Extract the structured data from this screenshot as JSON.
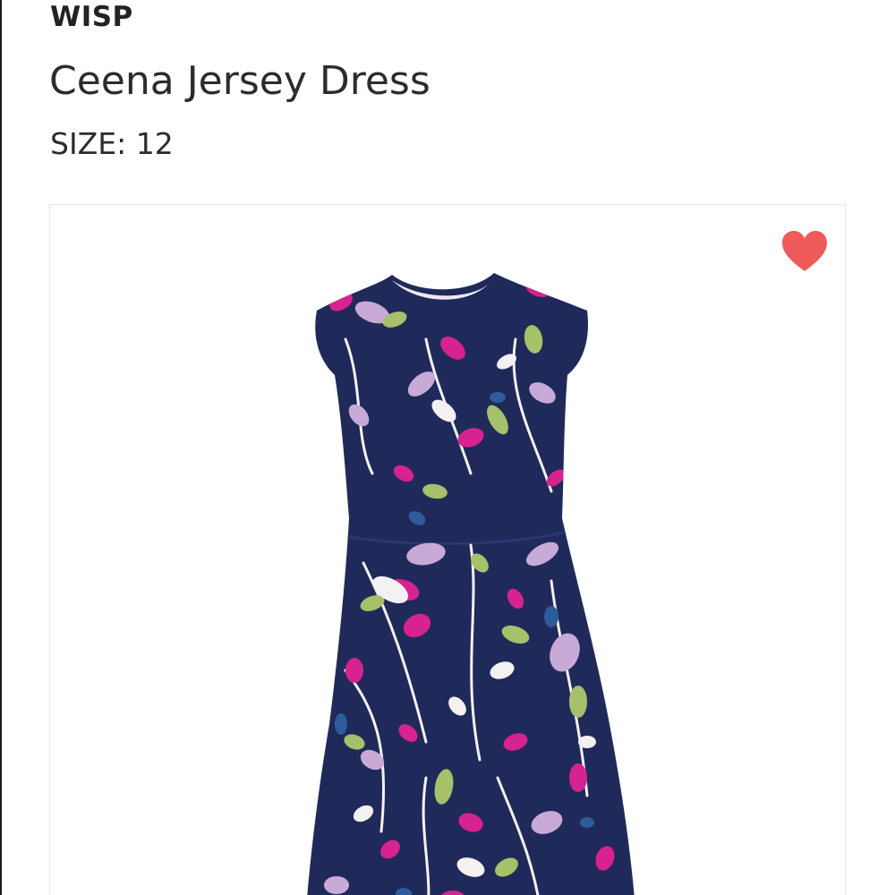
{
  "product": {
    "brand": "WISP",
    "name": "Ceena Jersey Dress",
    "size_label": "SIZE:",
    "size_value": "12"
  },
  "image": {
    "alt": "Ceena Jersey Dress",
    "favorite_icon": "heart-icon"
  },
  "colors": {
    "heart": "#EF5B5B",
    "dress_base": "#1F2A5A",
    "print_magenta": "#D6238F",
    "print_lavender": "#C9A9D6",
    "print_green": "#A7C06A",
    "print_white": "#F4F1F2",
    "print_blue": "#2E5C9A"
  }
}
